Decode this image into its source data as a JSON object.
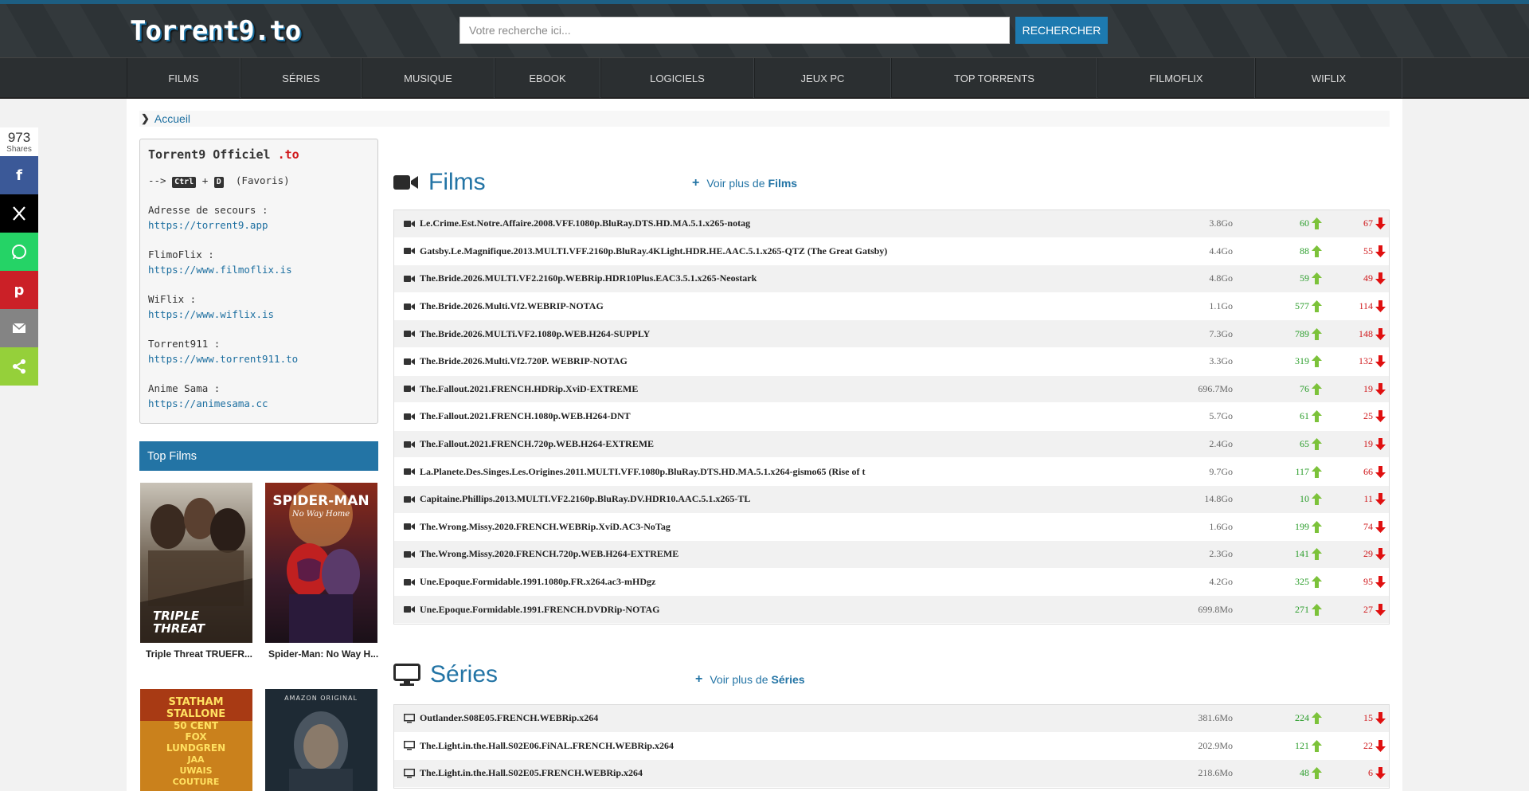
{
  "header": {
    "logo": "Torrent9.to",
    "search_placeholder": "Votre recherche ici...",
    "search_button": "RECHERCHER"
  },
  "nav": [
    "FILMS",
    "SÉRIES",
    "MUSIQUE",
    "EBOOK",
    "LOGICIELS",
    "JEUX PC",
    "TOP TORRENTS",
    "FILMOFLIX",
    "WIFLIX"
  ],
  "breadcrumb": "Accueil",
  "share": {
    "count": "973",
    "label": "Shares",
    "buttons": [
      {
        "name": "facebook",
        "color": "#3b5998"
      },
      {
        "name": "x",
        "color": "#000000"
      },
      {
        "name": "whatsapp",
        "color": "#25d366"
      },
      {
        "name": "pinterest",
        "color": "#cb2027"
      },
      {
        "name": "email",
        "color": "#848484"
      },
      {
        "name": "sharethis",
        "color": "#95d03a"
      }
    ]
  },
  "infobox": {
    "title": "Torrent9 Officiel ",
    "title_suffix": ".to",
    "shortcut_prefix": "-->",
    "key1": "Ctrl",
    "plus": "+",
    "key2": "D",
    "favoris": "(Favoris)",
    "secours_label": "Adresse de secours :",
    "secours_url": "https://torrent9.app",
    "filmoflix_label": "FlimoFlix :",
    "filmoflix_url": "https://www.filmoflix.is",
    "wiflix_label": "WiFlix :",
    "wiflix_url": "https://www.wiflix.is",
    "torrent911_label": "Torrent911 :",
    "torrent911_url": "https://www.torrent911.to",
    "animesama_label": "Anime Sama :",
    "animesama_url": "https://animesama.cc"
  },
  "top_films": {
    "title": "Top Films",
    "items": [
      "Triple Threat TRUEFR...",
      "Spider-Man: No Way H..."
    ]
  },
  "films": {
    "title": "Films",
    "more_prefix": "Voir plus de",
    "more_link": "Films",
    "rows": [
      {
        "name": "Le.Crime.Est.Notre.Affaire.2008.VFF.1080p.BluRay.DTS.HD.MA.5.1.x265-notag",
        "size": "3.8Go",
        "seed": "60",
        "leech": "67"
      },
      {
        "name": "Gatsby.Le.Magnifique.2013.MULTI.VFF.2160p.BluRay.4KLight.HDR.HE.AAC.5.1.x265-QTZ (The Great Gatsby)",
        "size": "4.4Go",
        "seed": "88",
        "leech": "55"
      },
      {
        "name": "The.Bride.2026.MULTI.VF2.2160p.WEBRip.HDR10Plus.EAC3.5.1.x265-Neostark",
        "size": "4.8Go",
        "seed": "59",
        "leech": "49"
      },
      {
        "name": "The.Bride.2026.Multi.Vf2.WEBRIP-NOTAG",
        "size": "1.1Go",
        "seed": "577",
        "leech": "114"
      },
      {
        "name": "The.Bride.2026.MULTi.VF2.1080p.WEB.H264-SUPPLY",
        "size": "7.3Go",
        "seed": "789",
        "leech": "148"
      },
      {
        "name": "The.Bride.2026.Multi.Vf2.720P. WEBRIP-NOTAG",
        "size": "3.3Go",
        "seed": "319",
        "leech": "132"
      },
      {
        "name": "The.Fallout.2021.FRENCH.HDRip.XviD-EXTREME",
        "size": "696.7Mo",
        "seed": "76",
        "leech": "19"
      },
      {
        "name": "The.Fallout.2021.FRENCH.1080p.WEB.H264-DNT",
        "size": "5.7Go",
        "seed": "61",
        "leech": "25"
      },
      {
        "name": "The.Fallout.2021.FRENCH.720p.WEB.H264-EXTREME",
        "size": "2.4Go",
        "seed": "65",
        "leech": "19"
      },
      {
        "name": "La.Planete.Des.Singes.Les.Origines.2011.MULTI.VFF.1080p.BluRay.DTS.HD.MA.5.1.x264-gismo65 (Rise of t",
        "size": "9.7Go",
        "seed": "117",
        "leech": "66"
      },
      {
        "name": "Capitaine.Phillips.2013.MULTI.VF2.2160p.BluRay.DV.HDR10.AAC.5.1.x265-TL",
        "size": "14.8Go",
        "seed": "10",
        "leech": "11"
      },
      {
        "name": "The.Wrong.Missy.2020.FRENCH.WEBRip.XviD.AC3-NoTag",
        "size": "1.6Go",
        "seed": "199",
        "leech": "74"
      },
      {
        "name": "The.Wrong.Missy.2020.FRENCH.720p.WEB.H264-EXTREME",
        "size": "2.3Go",
        "seed": "141",
        "leech": "29"
      },
      {
        "name": "Une.Epoque.Formidable.1991.1080p.FR.x264.ac3-mHDgz",
        "size": "4.2Go",
        "seed": "325",
        "leech": "95"
      },
      {
        "name": "Une.Epoque.Formidable.1991.FRENCH.DVDRip-NOTAG",
        "size": "699.8Mo",
        "seed": "271",
        "leech": "27"
      }
    ]
  },
  "series": {
    "title": "Séries",
    "more_prefix": "Voir plus de",
    "more_link": "Séries",
    "rows": [
      {
        "name": "Outlander.S08E05.FRENCH.WEBRip.x264",
        "size": "381.6Mo",
        "seed": "224",
        "leech": "15"
      },
      {
        "name": "The.Light.in.the.Hall.S02E06.FiNAL.FRENCH.WEBRip.x264",
        "size": "202.9Mo",
        "seed": "121",
        "leech": "22"
      },
      {
        "name": "The.Light.in.the.Hall.S02E05.FRENCH.WEBRip.x264",
        "size": "218.6Mo",
        "seed": "48",
        "leech": "6"
      }
    ]
  }
}
